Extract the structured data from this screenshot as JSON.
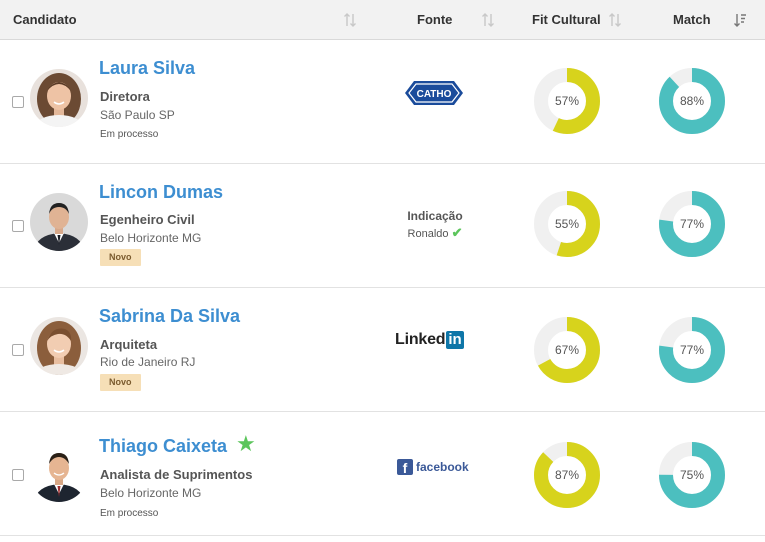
{
  "header": {
    "candidate": "Candidato",
    "source": "Fonte",
    "fit": "Fit Cultural",
    "match": "Match"
  },
  "colors": {
    "name_link": "#3d8ed1",
    "fit_ring": "#d7d31c",
    "match_ring": "#4cbfbf",
    "ring_track": "#f0f0f0",
    "badge_bg": "#f6dfb7",
    "star": "#5cc55c"
  },
  "candidates": [
    {
      "name": "Laura Silva",
      "role": "Diretora",
      "city": "São Paulo SP",
      "status": "Em processo",
      "source_logo": "catho-logo",
      "source_text": "CATHO",
      "fit_label": "57%",
      "fit_value": 0.57,
      "match_label": "88%",
      "match_value": 0.88
    },
    {
      "name": "Lincon Dumas",
      "role": "Egenheiro Civil",
      "city": "Belo Horizonte MG",
      "badge": "Novo",
      "source_title": "Indicação",
      "source_sub": "Ronaldo",
      "fit_label": "55%",
      "fit_value": 0.55,
      "match_label": "77%",
      "match_value": 0.77
    },
    {
      "name": "Sabrina Da Silva",
      "role": "Arquiteta",
      "city": "Rio de Janeiro RJ",
      "badge": "Novo",
      "source_logo": "linkedin-logo",
      "source_text": "Linked",
      "source_text_box": "in",
      "fit_label": "67%",
      "fit_value": 0.67,
      "match_label": "77%",
      "match_value": 0.77
    },
    {
      "name": "Thiago Caixeta",
      "role": "Analista de Suprimentos",
      "city": "Belo Horizonte MG",
      "status": "Em processo",
      "starred": true,
      "source_logo": "facebook-logo",
      "source_text": "facebook",
      "fit_label": "87%",
      "fit_value": 0.87,
      "match_label": "75%",
      "match_value": 0.75
    }
  ]
}
